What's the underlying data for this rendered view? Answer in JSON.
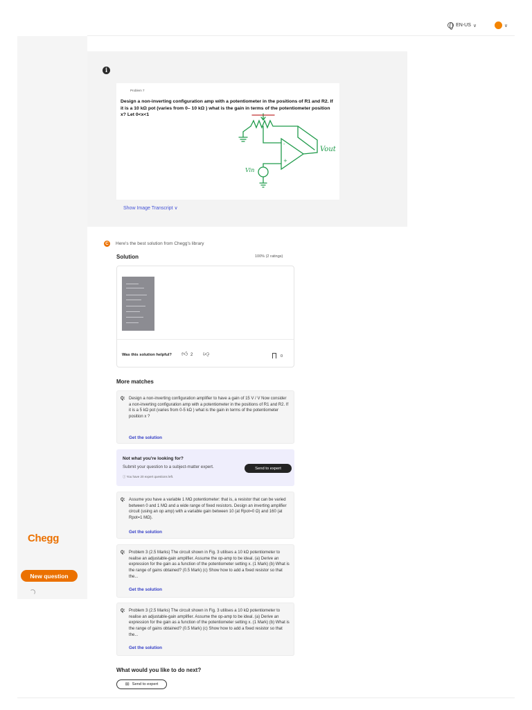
{
  "header": {
    "language": "EN-US",
    "language_chevron": "∨",
    "profile_chevron": "∨",
    "colors": {
      "avatar": "#f48400"
    }
  },
  "sidebar": {
    "logo": "Chegg",
    "new_question_label": "New question",
    "colors": {
      "brand": "#eb7100"
    }
  },
  "question": {
    "info_icon_glyph": "i",
    "problem_label": "Problem 7",
    "text": "Design a non-inverting configuration amp with a potentiometer in the positions of R1 and R2.  If it is a 10 kΩ pot (varies from 0– 10 kΩ ) what is the gain in terms of the potentiometer position x?  Let 0<x<1",
    "transcript_link": "Show Image Transcript ∨",
    "diagram_labels": {
      "output": "Vout",
      "input": "Vin"
    }
  },
  "solution": {
    "intro": "Here's the best solution from Chegg's library",
    "title": "Solution",
    "rating": "100% (2 ratings)",
    "helpful_label": "Was this solution helpful?",
    "like_count": "2",
    "bookmark_count": "0"
  },
  "more_matches": {
    "title": "More matches",
    "q_prefix": "Q:",
    "get_solution_label": "Get the solution",
    "items": [
      {
        "text": "Design a non-inverting configuration amplifier to have a gain of 15 V / V Now consider a non-inverting configuration amp with a potentiometer in the positions of R1 and R2. If it is a 5 kΩ pot (varies from 0-5 kΩ ) what is the gain in terms of the potentiometer position x ?"
      },
      {
        "text": "Assume you have a variable 1 MΩ potentiometer: that is, a resistor that can be varied between 0 and 1 MΩ and a wide range of fixed resistors. Design an inverting amplifier circuit (using an op amp) with a variable gain between 10 (at Rpot=0 Ω) and 160 (at Rpot=1 MΩ)."
      },
      {
        "text": "Problem 3 (2.5 Marks) The circuit shown in Fig. 3 utilises a 10 kΩ potentiometer to realise an adjustable-gain amplifier. Assume the op-amp to be ideal. (a) Derive an expression for the gain as a function of the potentiometer setting x. (1 Mark) (b) What is the range of gains obtained? (0.5 Mark) (c) Show how to add a fixed resistor so that the..."
      },
      {
        "text": "Problem 3 (2.5 Marks) The circuit shown in Fig. 3 utilises a 10 kΩ potentiometer to realise an adjustable-gain amplifier. Assume the op-amp to be ideal. (a) Derive an expression for the gain as a function of the potentiometer setting x. (1 Mark) (b) What is the range of gains obtained? (0.5 Mark) (c) Show how to add a fixed resistor so that the..."
      }
    ]
  },
  "not_found": {
    "title": "Not what you're looking for?",
    "subtitle": "Submit your question to a subject-matter expert.",
    "questions_left": "ⓘ You have 20 expert questions left.",
    "button_label": "Send to expert",
    "colors": {
      "background": "#efeefc",
      "button": "#232323"
    }
  },
  "next": {
    "title": "What would you like to do next?",
    "button_label": "Send to expert"
  }
}
